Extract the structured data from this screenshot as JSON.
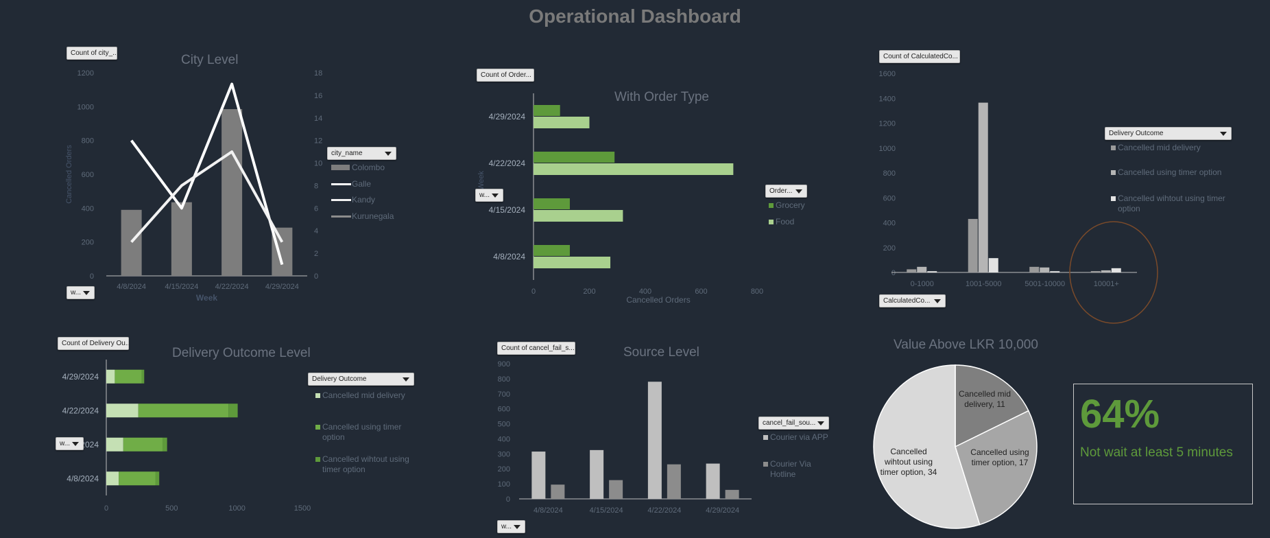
{
  "page_title": "Operational Dashboard",
  "colors": {
    "background": "#222a35",
    "grey_bar": "#7d7d7d",
    "light_bar": "#bfbfbf",
    "dark_green": "#5e9a3b",
    "mid_green": "#70ad47",
    "light_green": "#a9d08e",
    "pale_green": "#c5e0b4"
  },
  "city": {
    "field_button": "Count of city_...",
    "axis_button": "w...",
    "legend_button": "city_name",
    "title": "City Level",
    "xlabel": "Week",
    "ylabel": "Cancelled Orders",
    "categories": [
      "4/8/2024",
      "4/15/2024",
      "4/22/2024",
      "4/29/2024"
    ],
    "y_ticks": [
      "0",
      "200",
      "400",
      "600",
      "800",
      "1000",
      "1200"
    ],
    "y2_ticks": [
      "0",
      "2",
      "4",
      "6",
      "8",
      "10",
      "12",
      "14",
      "16",
      "18"
    ],
    "legend": [
      "Colombo",
      "Galle",
      "Kandy",
      "Kurunegala"
    ]
  },
  "order_type": {
    "field_button": "Count of Order...",
    "axis_button": "w...",
    "legend_button": "Order...",
    "title": "With Order Type",
    "xlabel": "Cancelled Orders",
    "ylabel": "Week",
    "categories": [
      "4/29/2024",
      "4/22/2024",
      "4/15/2024",
      "4/8/2024"
    ],
    "x_ticks": [
      "0",
      "200",
      "400",
      "600",
      "800"
    ],
    "legend": [
      "Grocery",
      "Food"
    ]
  },
  "value_buckets": {
    "field_button": "Count of CalculatedCo...",
    "axis_button": "CalculatedCo...",
    "legend_button": "Delivery Outcome",
    "categories": [
      "0-1000",
      "1001-5000",
      "5001-10000",
      "10001+"
    ],
    "y_ticks": [
      "0",
      "200",
      "400",
      "600",
      "800",
      "1000",
      "1200",
      "1400",
      "1600"
    ],
    "legend": [
      "Cancelled mid delivery",
      "Cancelled using timer option",
      "Cancelled wihtout using timer option"
    ]
  },
  "delivery_outcome": {
    "field_button": "Count of Delivery Ou...",
    "axis_button": "w...",
    "legend_button": "Delivery Outcome",
    "title": "Delivery Outcome Level",
    "categories": [
      "4/29/2024",
      "4/22/2024",
      "4/15/2024",
      "4/8/2024"
    ],
    "x_ticks": [
      "0",
      "500",
      "1000",
      "1500"
    ],
    "legend": [
      "Cancelled mid delivery",
      "Cancelled using timer option",
      "Cancelled wihtout using timer option"
    ]
  },
  "source": {
    "field_button": "Count of cancel_fail_s...",
    "axis_button": "w...",
    "legend_button": "cancel_fail_sou...",
    "title": "Source Level",
    "categories": [
      "4/8/2024",
      "4/15/2024",
      "4/22/2024",
      "4/29/2024"
    ],
    "y_ticks": [
      "0",
      "100",
      "200",
      "300",
      "400",
      "500",
      "600",
      "700",
      "800",
      "900"
    ],
    "legend": [
      "Courier via APP",
      "Courier Via Hotline"
    ]
  },
  "pie": {
    "title": "Value Above LKR 10,000",
    "labels": [
      "Cancelled mid delivery, 11",
      "Cancelled using timer option, 17",
      "Cancelled wihtout using timer option, 34"
    ]
  },
  "kpi": {
    "value": "64%",
    "text": "Not wait at least 5 minutes"
  },
  "chart_data": [
    {
      "type": "bar",
      "title": "City Level",
      "xlabel": "Week",
      "ylabel": "Cancelled Orders",
      "categories": [
        "4/8/2024",
        "4/15/2024",
        "4/22/2024",
        "4/29/2024"
      ],
      "ylim": [
        0,
        1200
      ],
      "y2lim": [
        0,
        18
      ],
      "series": [
        {
          "name": "Colombo",
          "chart": "bar",
          "axis": "primary",
          "values": [
            390,
            435,
            985,
            285
          ]
        },
        {
          "name": "Galle",
          "chart": "line",
          "axis": "secondary",
          "values": [
            12,
            6,
            17,
            1
          ]
        },
        {
          "name": "Kandy",
          "chart": "line",
          "axis": "secondary",
          "values": [
            3,
            8,
            11,
            3
          ]
        },
        {
          "name": "Kurunegala",
          "chart": "line",
          "axis": "secondary",
          "values": [
            0,
            0,
            0,
            0
          ]
        }
      ]
    },
    {
      "type": "bar",
      "orientation": "horizontal",
      "title": "With Order Type",
      "xlabel": "Cancelled Orders",
      "ylabel": "Week",
      "categories": [
        "4/29/2024",
        "4/22/2024",
        "4/15/2024",
        "4/8/2024"
      ],
      "xlim": [
        0,
        800
      ],
      "series": [
        {
          "name": "Grocery",
          "values": [
            95,
            290,
            130,
            130
          ]
        },
        {
          "name": "Food",
          "values": [
            200,
            715,
            320,
            275
          ]
        }
      ]
    },
    {
      "type": "bar",
      "categories": [
        "0-1000",
        "1001-5000",
        "5001-10000",
        "10001+"
      ],
      "ylim": [
        0,
        1600
      ],
      "series": [
        {
          "name": "Cancelled mid delivery",
          "values": [
            25,
            430,
            45,
            11
          ]
        },
        {
          "name": "Cancelled using timer option",
          "values": [
            45,
            1365,
            40,
            17
          ]
        },
        {
          "name": "Cancelled wihtout using timer option",
          "values": [
            10,
            115,
            10,
            34
          ]
        }
      ]
    },
    {
      "type": "bar",
      "orientation": "horizontal",
      "stacked": true,
      "title": "Delivery Outcome Level",
      "categories": [
        "4/29/2024",
        "4/22/2024",
        "4/15/2024",
        "4/8/2024"
      ],
      "xlim": [
        0,
        1500
      ],
      "series": [
        {
          "name": "Cancelled mid delivery",
          "values": [
            65,
            245,
            130,
            95
          ]
        },
        {
          "name": "Cancelled using timer option",
          "values": [
            205,
            690,
            300,
            280
          ]
        },
        {
          "name": "Cancelled wihtout using timer option",
          "values": [
            20,
            70,
            35,
            30
          ]
        }
      ]
    },
    {
      "type": "bar",
      "title": "Source Level",
      "categories": [
        "4/8/2024",
        "4/15/2024",
        "4/22/2024",
        "4/29/2024"
      ],
      "ylim": [
        0,
        900
      ],
      "series": [
        {
          "name": "Courier via APP",
          "values": [
            315,
            325,
            780,
            235
          ]
        },
        {
          "name": "Courier Via Hotline",
          "values": [
            95,
            125,
            230,
            60
          ]
        }
      ]
    },
    {
      "type": "pie",
      "title": "Value Above LKR 10,000",
      "labels": [
        "Cancelled mid delivery",
        "Cancelled using timer option",
        "Cancelled wihtout using timer option"
      ],
      "values": [
        11,
        17,
        34
      ]
    }
  ]
}
